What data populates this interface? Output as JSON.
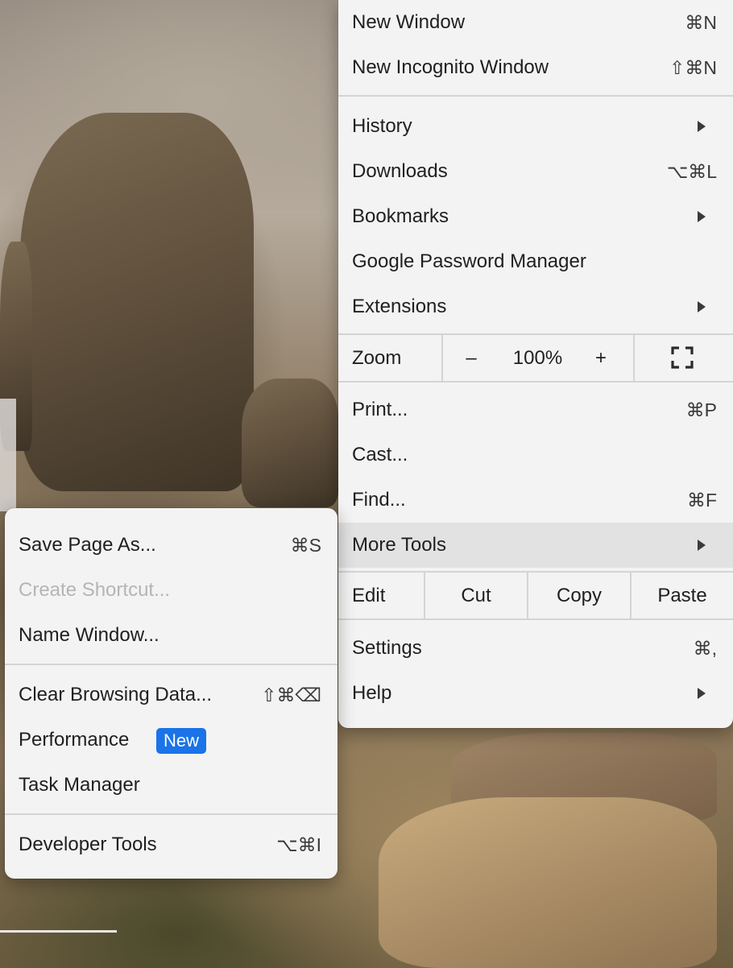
{
  "main_menu": {
    "new_window": {
      "label": "New Window",
      "shortcut": "⌘N"
    },
    "new_incognito": {
      "label": "New Incognito Window",
      "shortcut": "⇧⌘N"
    },
    "history": {
      "label": "History"
    },
    "downloads": {
      "label": "Downloads",
      "shortcut": "⌥⌘L"
    },
    "bookmarks": {
      "label": "Bookmarks"
    },
    "password_manager": {
      "label": "Google Password Manager"
    },
    "extensions": {
      "label": "Extensions"
    },
    "zoom": {
      "label": "Zoom",
      "minus": "–",
      "level": "100%",
      "plus": "+",
      "fullscreen_icon": "fullscreen-icon"
    },
    "print": {
      "label": "Print...",
      "shortcut": "⌘P"
    },
    "cast": {
      "label": "Cast..."
    },
    "find": {
      "label": "Find...",
      "shortcut": "⌘F"
    },
    "more_tools": {
      "label": "More Tools"
    },
    "edit": {
      "label": "Edit",
      "cut": "Cut",
      "copy": "Copy",
      "paste": "Paste"
    },
    "settings": {
      "label": "Settings",
      "shortcut": "⌘,"
    },
    "help": {
      "label": "Help"
    }
  },
  "more_tools_menu": {
    "save_page": {
      "label": "Save Page As...",
      "shortcut": "⌘S"
    },
    "create_shortcut": {
      "label": "Create Shortcut..."
    },
    "name_window": {
      "label": "Name Window..."
    },
    "clear_browsing": {
      "label": "Clear Browsing Data...",
      "shortcut": "⇧⌘⌫"
    },
    "performance": {
      "label": "Performance",
      "badge": "New"
    },
    "task_manager": {
      "label": "Task Manager"
    },
    "developer_tools": {
      "label": "Developer Tools",
      "shortcut": "⌥⌘I"
    }
  },
  "colors": {
    "menu_bg": "#f3f3f3",
    "highlight": "#e2e2e2",
    "badge": "#1a73e8",
    "disabled_text": "#b5b5b5"
  }
}
